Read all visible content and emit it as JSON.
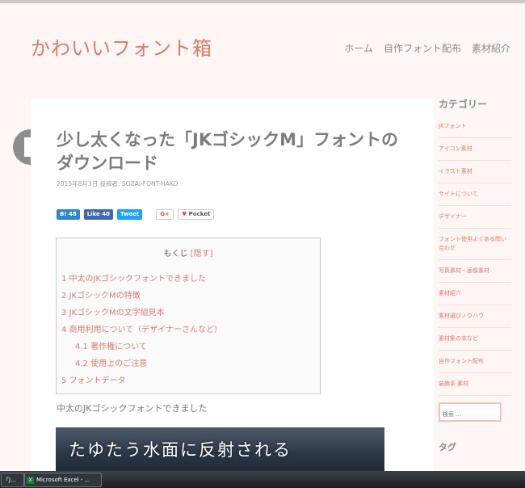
{
  "site": {
    "title": "かわいいフォント箱"
  },
  "nav": [
    "ホーム",
    "自作フォント配布",
    "素材紹介"
  ],
  "post": {
    "title": "少し太くなった「JKゴシックM」フォントのダウンロード",
    "meta": "2015年8月3日 投稿者: SOZAI-FONT-HAKO"
  },
  "share": {
    "hatena": "B! 48",
    "facebook": "Like 40",
    "twitter": "Tweet",
    "gplus": "G+",
    "pocket": "Pocket"
  },
  "toc": {
    "title": "もくじ",
    "hide": "[隠す]",
    "items": [
      "1 中太のJKゴシックフォントできました",
      "2 JKゴシックMの特徴",
      "3 JKゴシックMの文字組見本",
      "4 商用利用について（デザイナーさんなど）",
      "4.1 著作権について",
      "4.2 使用上のご注意",
      "5 フォントデータ"
    ]
  },
  "section": {
    "heading": "中太のJKゴシックフォントできました"
  },
  "hero": {
    "text": "たゆたう水面に反射される"
  },
  "sidebar": {
    "category_title": "カテゴリー",
    "categories": [
      "JKフォント",
      "アイコン素材",
      "イラスト素材",
      "サイトについて",
      "デザイナー",
      "フォント使用よくある問い合わせ",
      "写真素材・画像素材",
      "素材紹介",
      "素材選びノウハウ",
      "素材集の本など",
      "自作フォント配布",
      "装飾系 素材"
    ],
    "search_placeholder": "検索 …",
    "tag_title": "タグ"
  },
  "taskbar": {
    "items": [
      "「J...",
      "Microsoft Excel - ..."
    ]
  },
  "colors": {
    "accent": "#e0786a",
    "background": "#fdf6f4"
  }
}
